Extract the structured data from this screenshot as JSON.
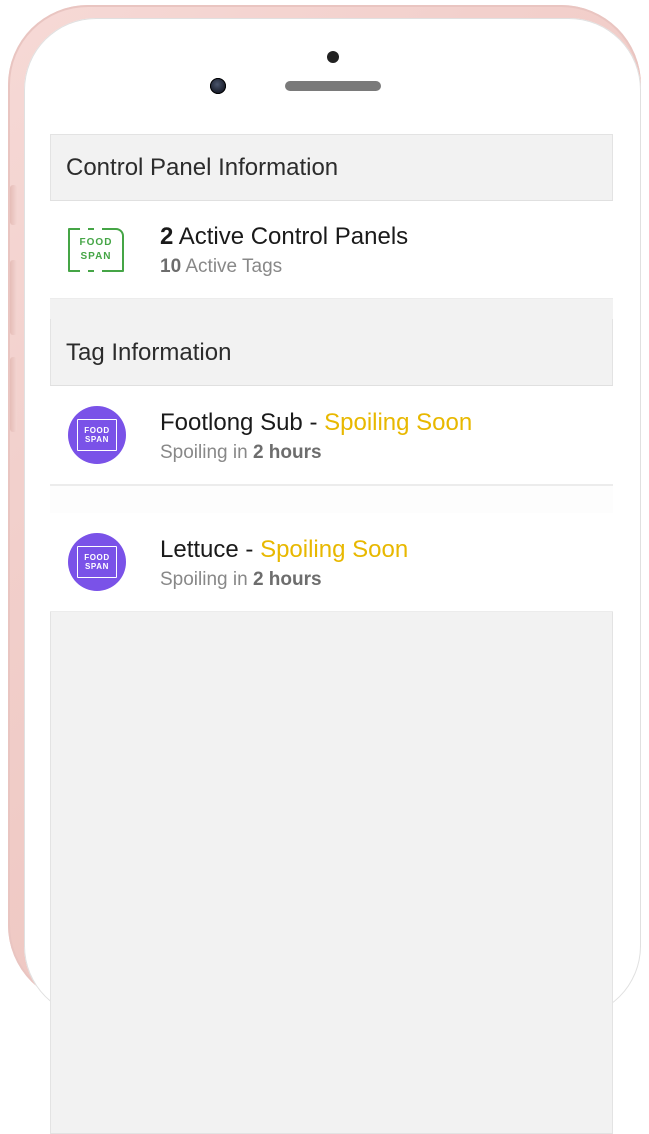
{
  "logo": {
    "line1": "FOOD",
    "line2": "SPAN"
  },
  "section_control": {
    "header": "Control Panel Information",
    "count": "2",
    "count_label": " Active Control Panels",
    "sub_count": "10",
    "sub_label": " Active Tags"
  },
  "section_tags": {
    "header": "Tag Information"
  },
  "tags": [
    {
      "name": "Footlong Sub",
      "dash": " - ",
      "status": "Spoiling Soon",
      "sub_prefix": "Spoiling in ",
      "sub_bold": "2 hours"
    },
    {
      "name": "Lettuce",
      "dash": " - ",
      "status": "Spoiling Soon",
      "sub_prefix": "Spoiling in ",
      "sub_bold": "2 hours"
    }
  ]
}
